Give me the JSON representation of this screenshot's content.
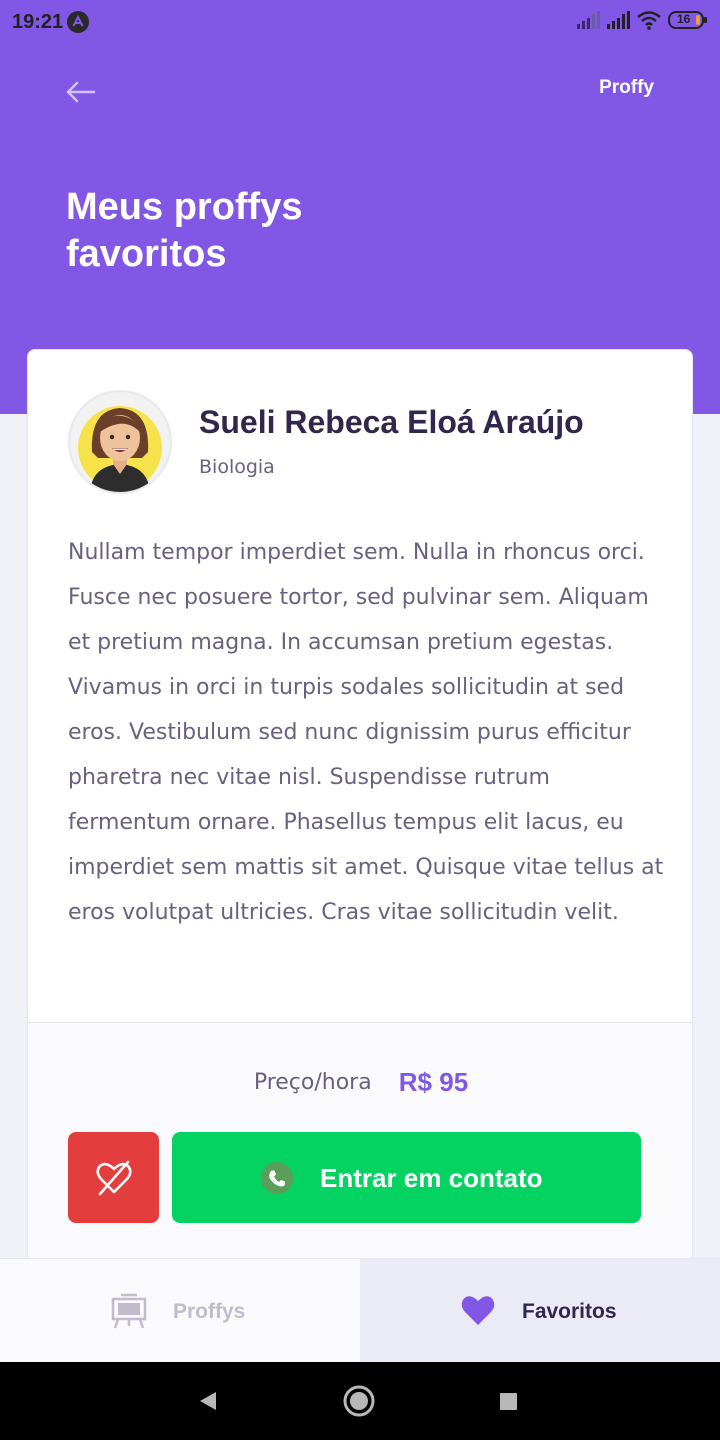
{
  "status_bar": {
    "time": "19:21",
    "battery": "16"
  },
  "header": {
    "brand": "Proffy",
    "title": "Meus proffys favoritos"
  },
  "card": {
    "name": "Sueli Rebeca Eloá Araújo",
    "subject": "Biologia",
    "bio": "Nullam tempor imperdiet sem. Nulla in rhoncus orci. Fusce nec posuere tortor, sed pulvinar sem. Aliquam et pretium magna. In accumsan pretium egestas. Vivamus in orci in turpis sodales sollicitudin at sed eros. Vestibulum sed nunc dignissim purus efficitur pharetra nec vitae nisl. Suspendisse rutrum fermentum ornare. Phasellus tempus elit lacus, eu imperdiet sem mattis sit amet. Quisque vitae tellus at eros volutpat ultricies. Cras vitae sollicitudin velit.",
    "price_label": "Preço/hora",
    "price_value": "R$ 95",
    "contact_label": "Entrar em contato"
  },
  "tabs": [
    {
      "label": "Proffys",
      "icon": "easel-icon",
      "active": false
    },
    {
      "label": "Favoritos",
      "icon": "heart-icon",
      "active": true
    }
  ],
  "colors": {
    "primary": "#8257e5",
    "danger": "#e33d3d",
    "success": "#04d361",
    "title": "#32264d",
    "text": "#6a6180"
  }
}
